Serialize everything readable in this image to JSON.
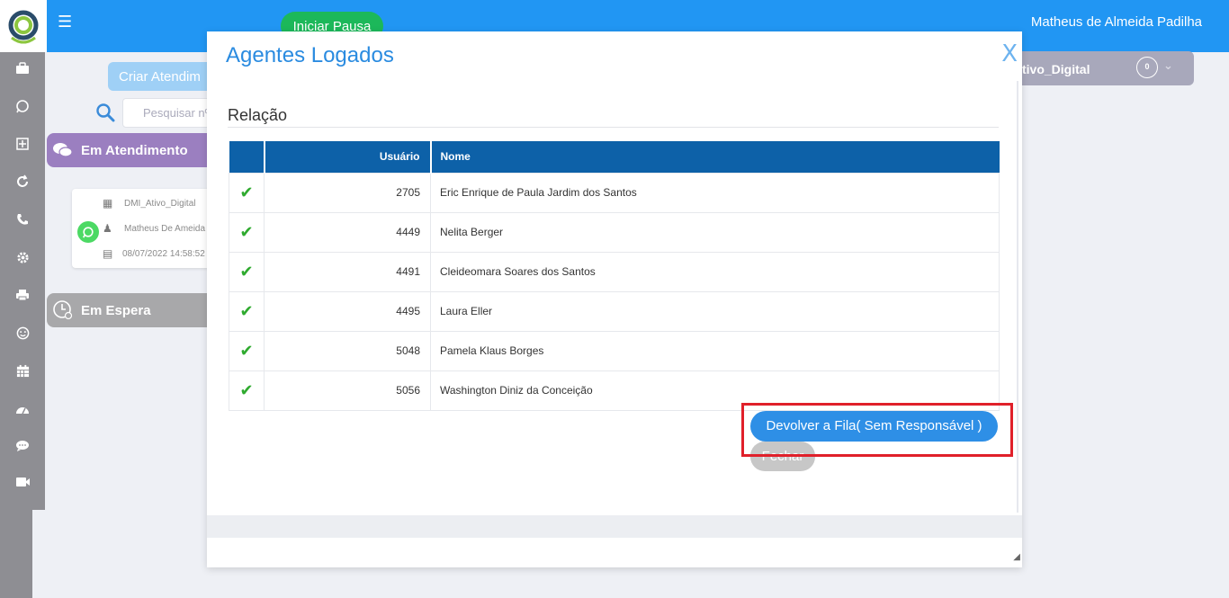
{
  "header": {
    "menu_icon": "☰",
    "pause_label": "Iniciar Pausa",
    "user_name": "Matheus de Almeida Padilha"
  },
  "sidebar": {
    "icons": [
      "briefcase-icon",
      "whatsapp-icon",
      "grid-plus-icon",
      "refresh-icon",
      "phone-icon",
      "gear-icon",
      "printer-icon",
      "smile-icon",
      "calendar-icon",
      "dashboard-icon",
      "chat-icon",
      "video-icon"
    ]
  },
  "background": {
    "create_label": "Criar Atendim",
    "search_placeholder": "Pesquisar nº",
    "section_atendimento": "Em Atendimento",
    "section_espera": "Em Espera",
    "card": {
      "queue": "DMI_Ativo_Digital",
      "agent": "Matheus De Ameida",
      "datetime": "08/07/2022 14:58:52"
    },
    "queue_chip": {
      "label": "tivo_Digital",
      "count": "0"
    }
  },
  "modal": {
    "title": "Agentes Logados",
    "close_label": "X",
    "section_title": "Relação",
    "columns": {
      "user": "Usuário",
      "name": "Nome"
    },
    "rows": [
      {
        "user": "2705",
        "name": "Eric Enrique de Paula Jardim dos Santos"
      },
      {
        "user": "4449",
        "name": "Nelita Berger"
      },
      {
        "user": "4491",
        "name": "Cleideomara Soares dos Santos"
      },
      {
        "user": "4495",
        "name": "Laura Eller"
      },
      {
        "user": "5048",
        "name": "Pamela Klaus Borges"
      },
      {
        "user": "5056",
        "name": "Washington Diniz da Conceição"
      }
    ],
    "return_button": "Devolver a Fila( Sem Responsável )",
    "close_button": "Fechar"
  },
  "colors": {
    "brand_blue": "#2196f3",
    "table_header": "#0d61a8",
    "check_green": "#2faa2f",
    "highlight_red": "#e0202a"
  }
}
